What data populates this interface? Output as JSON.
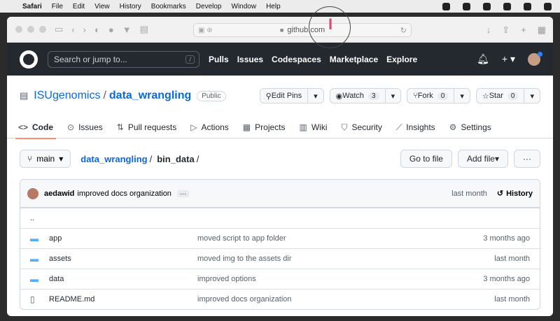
{
  "menubar": {
    "app": "Safari",
    "items": [
      "File",
      "Edit",
      "View",
      "History",
      "Bookmarks",
      "Develop",
      "Window",
      "Help"
    ]
  },
  "browser": {
    "url": "github.com"
  },
  "github": {
    "search_placeholder": "Search or jump to...",
    "search_key": "/",
    "nav": [
      "Pulls",
      "Issues",
      "Codespaces",
      "Marketplace",
      "Explore"
    ],
    "owner": "ISUgenomics",
    "repo": "data_wrangling",
    "visibility": "Public",
    "actions": {
      "edit_pins": "Edit Pins",
      "watch": "Watch",
      "watch_count": "3",
      "fork": "Fork",
      "fork_count": "0",
      "star": "Star",
      "star_count": "0"
    },
    "tabs": [
      "Code",
      "Issues",
      "Pull requests",
      "Actions",
      "Projects",
      "Wiki",
      "Security",
      "Insights",
      "Settings"
    ],
    "branch": "main",
    "path": {
      "root": "data_wrangling",
      "current": "bin_data"
    },
    "buttons": {
      "goto": "Go to file",
      "add": "Add file",
      "more": "···"
    },
    "commit": {
      "author": "aedawid",
      "message": "improved docs organization",
      "time": "last month",
      "history": "History"
    },
    "parent": "..",
    "files": [
      {
        "name": "app",
        "message": "moved script to app folder",
        "time": "3 months ago",
        "type": "folder"
      },
      {
        "name": "assets",
        "message": "moved img to the assets dir",
        "time": "last month",
        "type": "folder"
      },
      {
        "name": "data",
        "message": "improved options",
        "time": "3 months ago",
        "type": "folder"
      },
      {
        "name": "README.md",
        "message": "improved docs organization",
        "time": "last month",
        "type": "file"
      }
    ]
  }
}
